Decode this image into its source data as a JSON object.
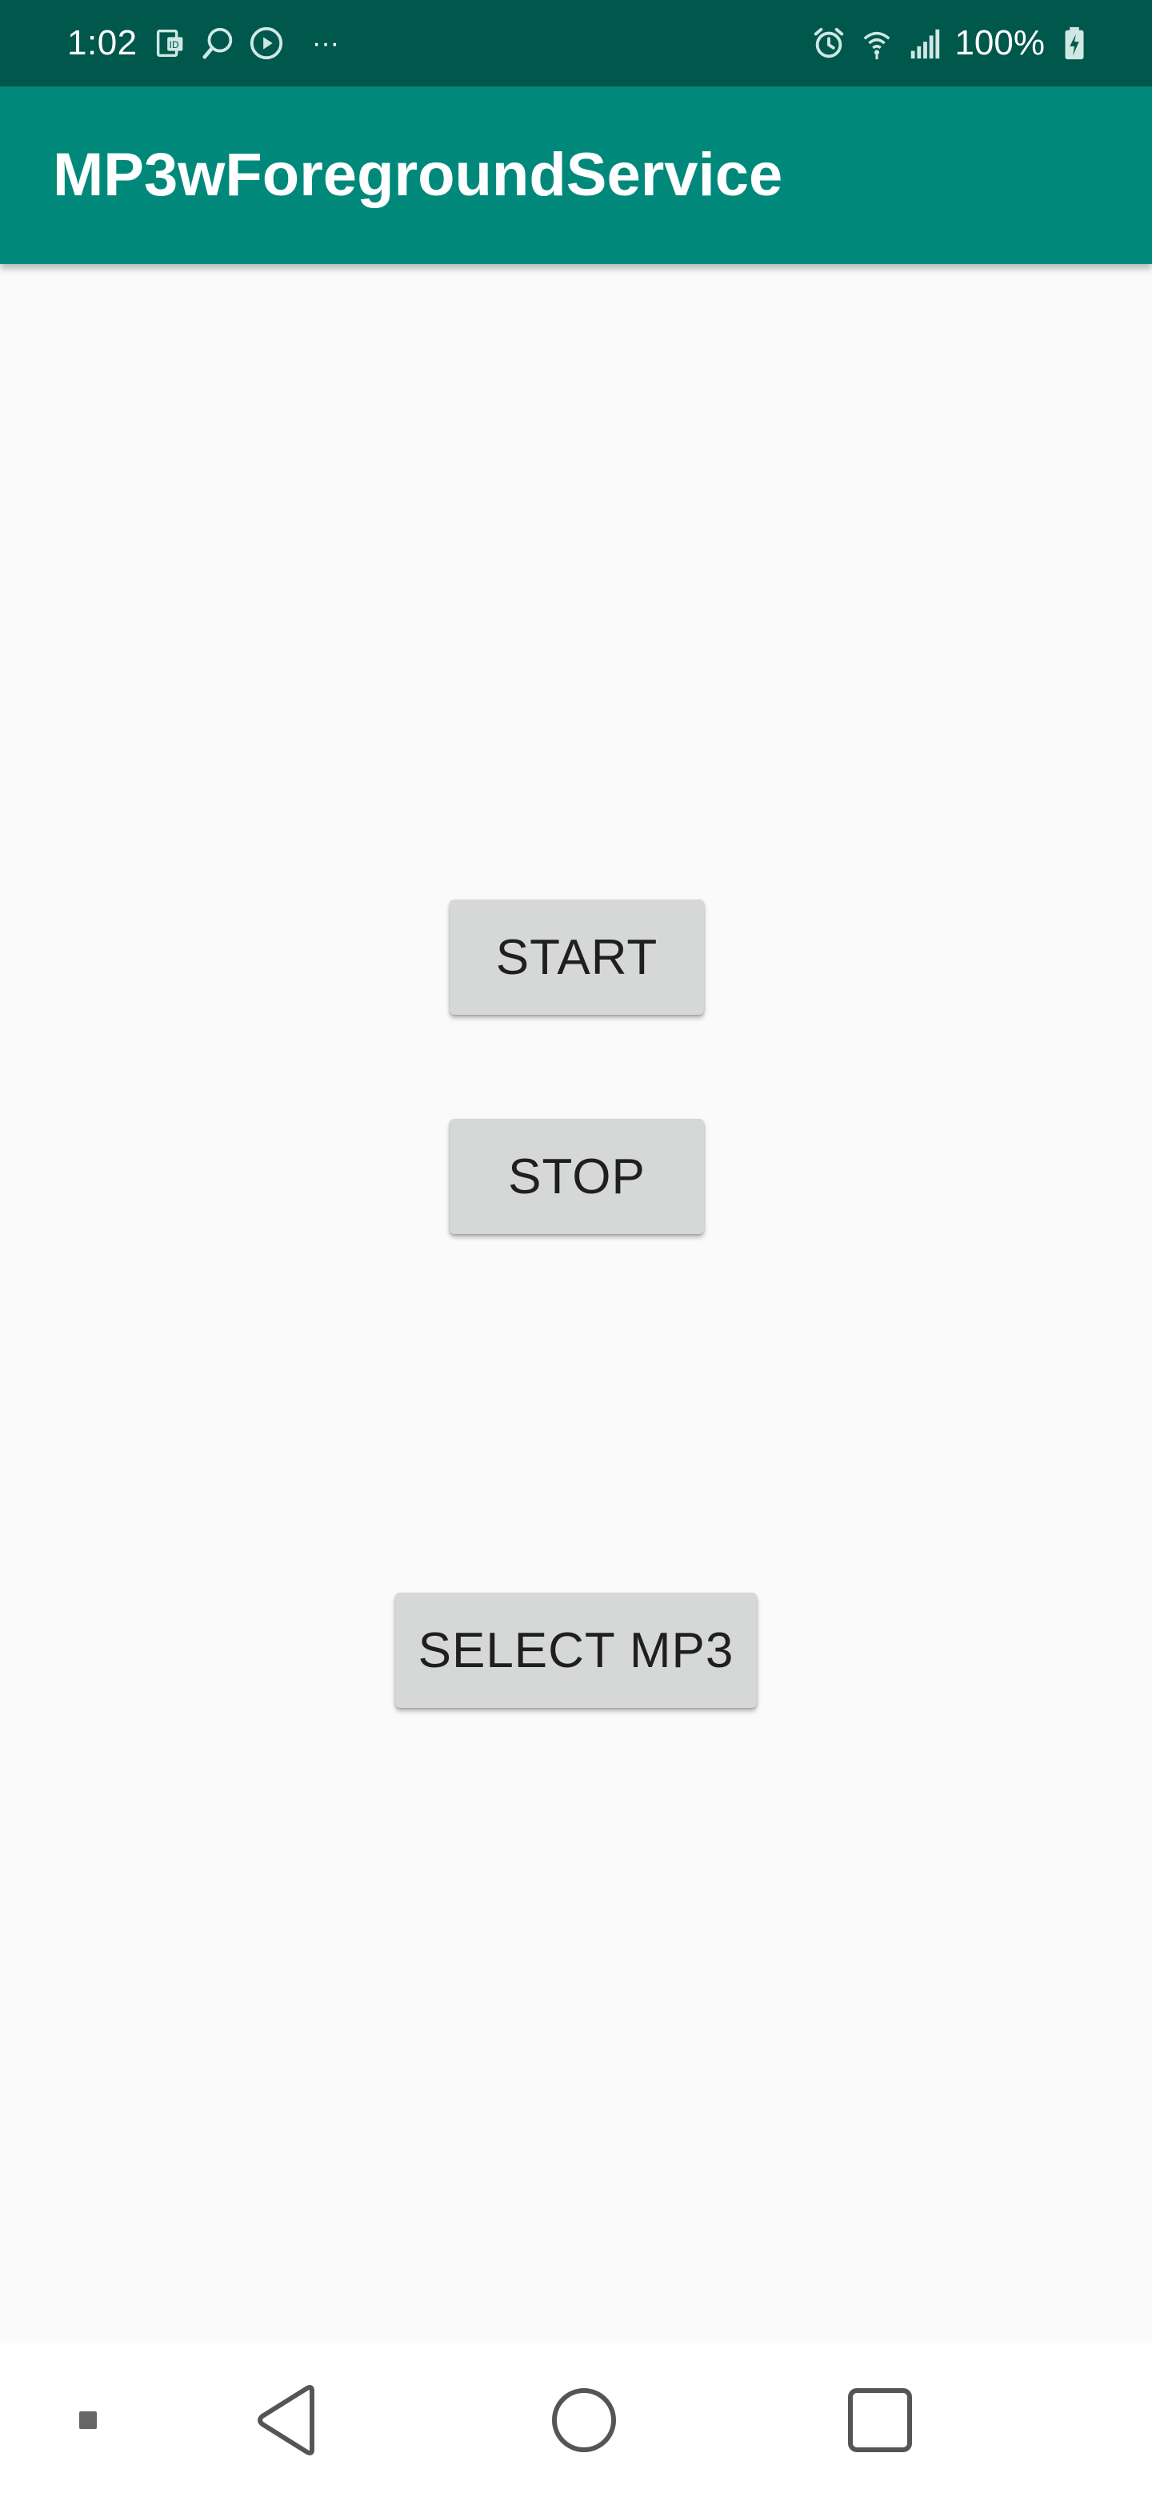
{
  "status_bar": {
    "time": "1:02",
    "left_icons": [
      "id-card-icon",
      "search-icon",
      "play-circle-icon"
    ],
    "overflow": "···",
    "right_icons": [
      "alarm-icon",
      "wifi-icon",
      "signal-icon"
    ],
    "battery_percent": "100%",
    "background_color": "#00574b"
  },
  "app_bar": {
    "title": "MP3wForegroundService",
    "background_color": "#00897b"
  },
  "buttons": {
    "start_label": "START",
    "stop_label": "STOP",
    "select_label": "SELECT MP3"
  },
  "nav_bar": {
    "items": [
      "square-dot-icon",
      "back-icon",
      "home-icon",
      "recent-apps-icon"
    ]
  }
}
